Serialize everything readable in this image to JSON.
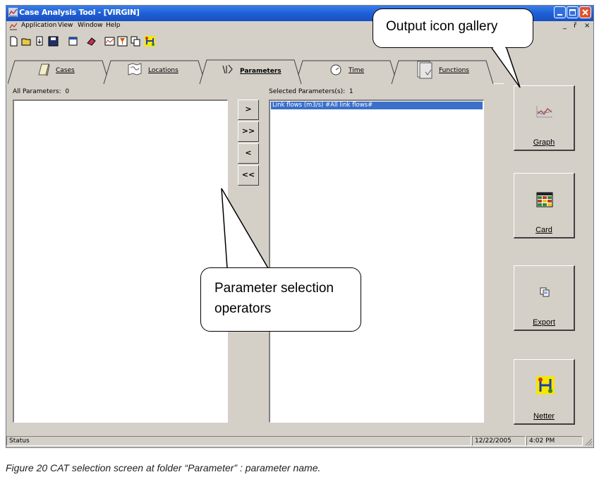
{
  "window": {
    "title": "Case Analysis Tool - [VIRGIN]",
    "controls": [
      "minimize-icon",
      "maximize-icon",
      "close-icon"
    ],
    "mdi_controls": [
      "_",
      "ř",
      "×"
    ]
  },
  "menu": [
    "Application",
    "View",
    "Window",
    "Help"
  ],
  "toolbar": [
    "new-file-icon",
    "open-folder-icon",
    "import-icon",
    "save-icon",
    "properties-icon",
    "eraser-icon",
    "chart-icon",
    "filter-icon",
    "copy-icon",
    "netter-icon"
  ],
  "tabs": [
    {
      "label": "Cases",
      "icon": "folder-icon",
      "active": false
    },
    {
      "label": "Locations",
      "icon": "map-icon",
      "active": false
    },
    {
      "label": "Parameters",
      "icon": "parameters-icon",
      "active": true
    },
    {
      "label": "Time",
      "icon": "clock-icon",
      "active": false
    },
    {
      "label": "Functions",
      "icon": "document-icon",
      "active": false
    }
  ],
  "all_parameters": {
    "label": "All Parameters:",
    "count": "0"
  },
  "selected_parameters": {
    "label": "Selected Parameters(s):",
    "count": "1",
    "items": [
      "Link flows (m3/s) #All link flows#"
    ]
  },
  "operators": [
    ">",
    ">>",
    "<",
    "<<"
  ],
  "gallery": [
    {
      "label": "Graph",
      "icon": "graph-icon"
    },
    {
      "label": "Card",
      "icon": "card-icon"
    },
    {
      "label": "Export",
      "icon": "export-icon"
    },
    {
      "label": "Netter",
      "icon": "netter-icon"
    }
  ],
  "status": {
    "text": "Status",
    "date": "12/22/2005",
    "time": "4:02 PM"
  },
  "callouts": {
    "gallery": "Output icon gallery",
    "operators": "Parameter selection operators"
  },
  "caption": "Figure 20 CAT selection screen at folder “Parameter” : parameter name.",
  "colors": {
    "title_bar": "#1e5fd6",
    "selection": "#3b6fc9",
    "face": "#d4d0c8",
    "close_button": "#e0512c"
  }
}
